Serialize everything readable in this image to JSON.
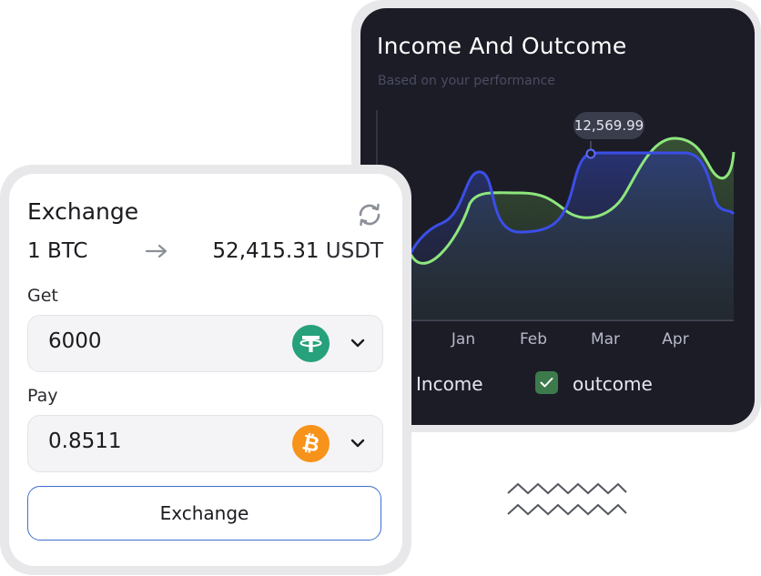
{
  "chart_card": {
    "title": "Income And Outcome",
    "subtitle": "Based on your performance",
    "tooltip_value": "12,569.99",
    "colors": {
      "background": "#1c1c27",
      "income_line": "#3b4ee8",
      "outcome_line": "#8ee67d",
      "checkbox": "#3c7a4b"
    },
    "legend": {
      "income_label": "Income",
      "outcome_label": "outcome",
      "outcome_checked": true
    }
  },
  "chart_data": {
    "type": "line",
    "x": [
      "Jan",
      "Feb",
      "Mar",
      "Apr"
    ],
    "title": "Income And Outcome",
    "subtitle": "Based on your performance",
    "annotation": "12,569.99",
    "grid": false,
    "series": [
      {
        "name": "Income",
        "color": "#3b4ee8"
      },
      {
        "name": "outcome",
        "color": "#8ee67d"
      }
    ]
  },
  "exchange_card": {
    "title": "Exchange",
    "rate_from": "1 BTC",
    "rate_to_amount": "52,415.31",
    "rate_to_unit": "USDT",
    "get_label": "Get",
    "get_value": "6000",
    "get_coin_icon": "tether-icon",
    "pay_label": "Pay",
    "pay_value": "0.8511",
    "pay_coin_icon": "bitcoin-icon",
    "button_label": "Exchange",
    "colors": {
      "tether": "#26a17b",
      "bitcoin": "#f7931a",
      "button_border": "#3f6fd0"
    }
  }
}
